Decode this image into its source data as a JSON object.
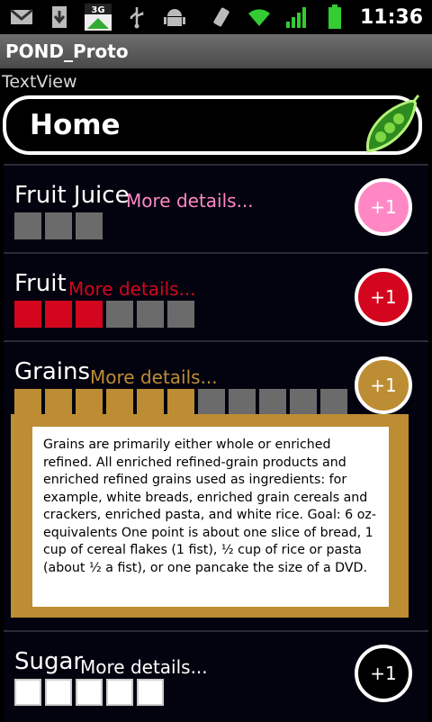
{
  "status_bar": {
    "time": "11:36",
    "network_type": "3G",
    "icons": [
      "gmail-icon",
      "download-icon",
      "3g-data-icon",
      "usb-icon",
      "android-debug-icon",
      "vibrate-icon",
      "wifi-icon",
      "signal-icon",
      "battery-icon"
    ]
  },
  "app": {
    "title": "POND_Proto",
    "textview_label": "TextView",
    "home_label": "Home"
  },
  "colors": {
    "fruit_juice": "#ff88c4",
    "fruit": "#d4061e",
    "grains": "#bd8d33",
    "sugar": "#000000",
    "empty": "#6b6b6b"
  },
  "groups": [
    {
      "name": "Fruit Juice",
      "more": "More details...",
      "button": "+1",
      "filled": 0,
      "total": 3
    },
    {
      "name": "Fruit",
      "more": "More details...",
      "button": "+1",
      "filled": 3,
      "total": 6
    },
    {
      "name": "Grains",
      "more": "More details...",
      "button": "+1",
      "filled": 6,
      "total": 11,
      "details": "Grains are primarily either whole or enriched refined. All enriched refined-grain products and enriched refined grains used as ingredients: for example, white breads, enriched grain cereals and crackers, enriched pasta, and white rice. Goal: 6 oz-equivalents One point is about one slice of bread, 1 cup of cereal flakes (1 fist), ½ cup of rice or pasta (about ½ a fist), or one pancake the size of a DVD."
    },
    {
      "name": "Sugar",
      "more": "More details...",
      "button": "+1",
      "filled": 0,
      "total": 5
    }
  ]
}
